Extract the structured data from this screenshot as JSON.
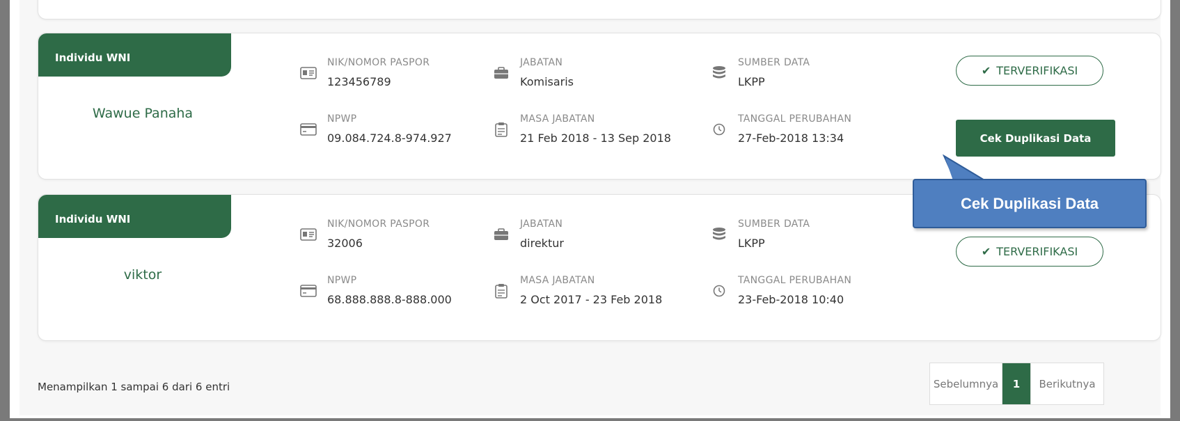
{
  "records": [
    {
      "type_label": "Individu WNI",
      "name": "Wawue Panaha",
      "nik_label": "NIK/NOMOR PASPOR",
      "nik_value": "123456789",
      "npwp_label": "NPWP",
      "npwp_value": "09.084.724.8-974.927",
      "jabatan_label": "JABATAN",
      "jabatan_value": "Komisaris",
      "masa_label": "MASA JABATAN",
      "masa_value": "21 Feb 2018 - 13 Sep 2018",
      "sumber_label": "SUMBER DATA",
      "sumber_value": "LKPP",
      "tanggal_label": "TANGGAL PERUBAHAN",
      "tanggal_value": "27-Feb-2018 13:34",
      "status": "TERVERIFIKASI",
      "action_label": "Cek Duplikasi Data"
    },
    {
      "type_label": "Individu WNI",
      "name": "viktor",
      "nik_label": "NIK/NOMOR PASPOR",
      "nik_value": "32006",
      "npwp_label": "NPWP",
      "npwp_value": "68.888.888.8-888.000",
      "jabatan_label": "JABATAN",
      "jabatan_value": "direktur",
      "masa_label": "MASA JABATAN",
      "masa_value": "2 Oct 2017 - 23 Feb 2018",
      "sumber_label": "SUMBER DATA",
      "sumber_value": "LKPP",
      "tanggal_label": "TANGGAL PERUBAHAN",
      "tanggal_value": "23-Feb-2018 10:40",
      "status": "TERVERIFIKASI"
    }
  ],
  "callout": {
    "text": "Cek Duplikasi Data"
  },
  "footer": {
    "entries_info": "Menampilkan 1 sampai 6 dari 6 entri"
  },
  "pagination": {
    "prev": "Sebelumnya",
    "current": "1",
    "next": "Berikutnya"
  },
  "colors": {
    "primary_green": "#2e6b47",
    "callout_blue": "#4f7fc0",
    "frame_gray": "#7a7a7a"
  }
}
